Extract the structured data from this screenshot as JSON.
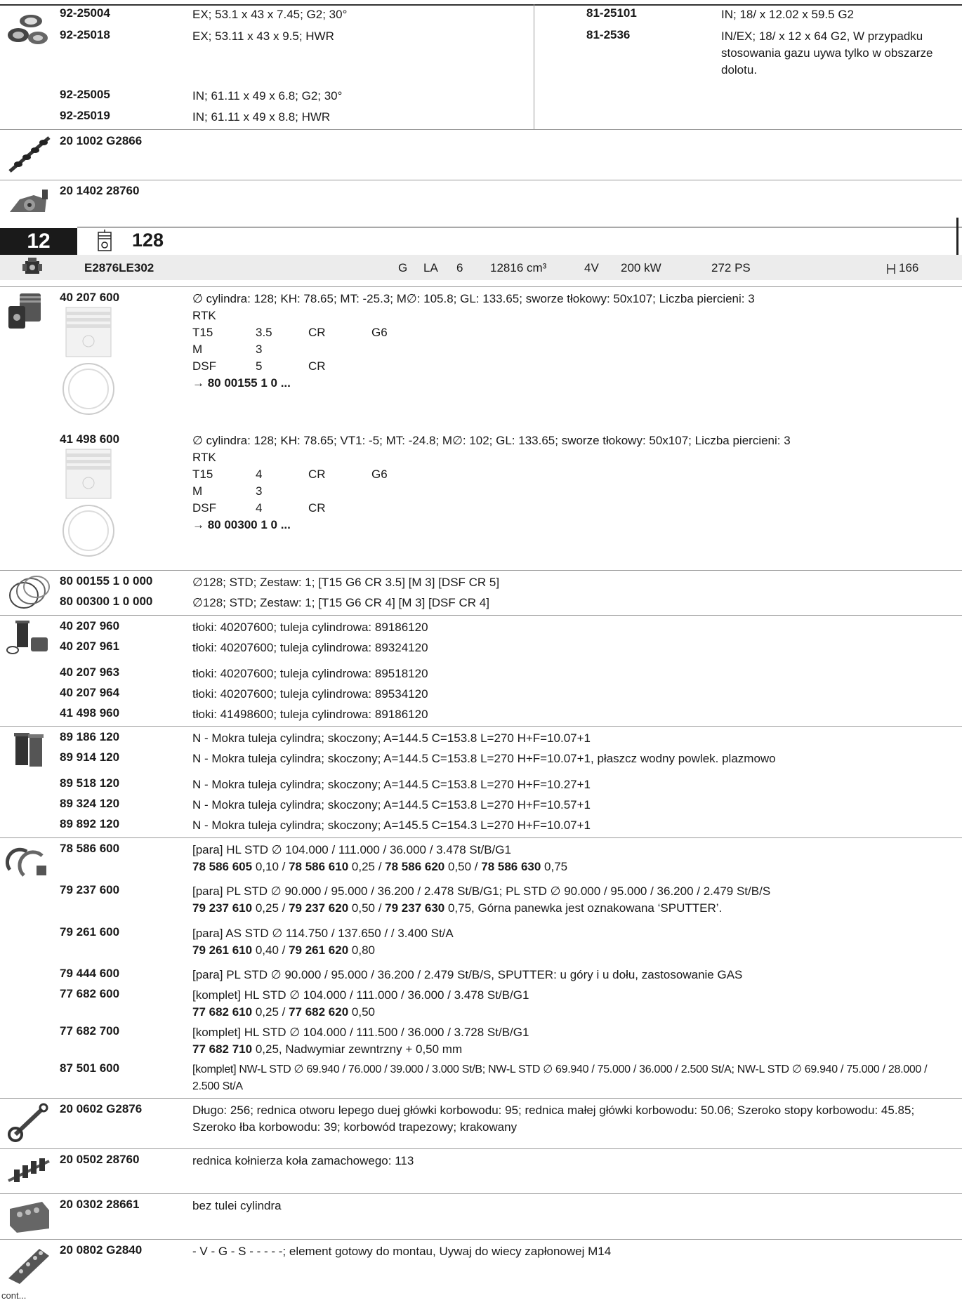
{
  "top_block": {
    "left": [
      {
        "pn": "92-25004",
        "desc": "EX; 53.1 x 43 x 7.45; G2; 30°"
      },
      {
        "pn": "92-25018",
        "desc": "EX; 53.11 x 43 x 9.5; HWR"
      },
      {
        "pn": "92-25005",
        "desc": "IN; 61.11 x 49 x 6.8; G2; 30°"
      },
      {
        "pn": "92-25019",
        "desc": "IN; 61.11 x 49 x 8.8; HWR"
      }
    ],
    "right": [
      {
        "pn": "81-25101",
        "desc": "IN; 18/ x 12.02 x 59.5 G2"
      },
      {
        "pn": "81-2536",
        "desc": "IN/EX; 18/ x 12 x 64 G2, W przypadku stosowania gazu uywa tylko w obszarze dolotu."
      }
    ]
  },
  "camshaft": {
    "pn": "20 1002 G2866"
  },
  "housing": {
    "pn": "20 1402 28760"
  },
  "engine_header": {
    "number": "12",
    "bore": "128",
    "code": "E2876LE302",
    "fuel": "G",
    "aspiration": "LA",
    "cylinders": "6",
    "displacement": "12816 cm³",
    "valves": "4V",
    "power_kw": "200 kW",
    "power_ps": "272 PS",
    "stroke": "166"
  },
  "pistons": [
    {
      "pn": "40 207 600",
      "desc": "∅ cylindra: 128; KH: 78.65; MT: -25.3; M∅: 105.8; GL: 133.65; sworze tłokowy: 50x107; Liczba piercieni: 3",
      "label": "RTK",
      "rings": [
        [
          "T15",
          "3.5",
          "CR",
          "G6"
        ],
        [
          "M",
          "3",
          "",
          ""
        ],
        [
          "DSF",
          "5",
          "CR",
          ""
        ]
      ],
      "ref": "→ 80 00155 1 0 ..."
    },
    {
      "pn": "41 498 600",
      "desc": "∅ cylindra: 128; KH: 78.65; VT1: -5; MT: -24.8; M∅: 102; GL: 133.65; sworze tłokowy: 50x107; Liczba piercieni: 3",
      "label": "RTK",
      "rings": [
        [
          "T15",
          "4",
          "CR",
          "G6"
        ],
        [
          "M",
          "3",
          "",
          ""
        ],
        [
          "DSF",
          "4",
          "CR",
          ""
        ]
      ],
      "ref": "→ 80 00300 1 0 ..."
    }
  ],
  "ring_sets": [
    {
      "pn": "80 00155 1 0 000",
      "desc": "∅128; STD; Zestaw: 1; [T15 G6 CR 3.5] [M 3] [DSF CR 5]"
    },
    {
      "pn": "80 00300 1 0 000",
      "desc": "∅128; STD; Zestaw: 1; [T15 G6 CR 4] [M 3] [DSF CR 4]"
    }
  ],
  "kits": [
    {
      "pn": "40 207 960",
      "desc": "tłoki: 40207600; tuleja cylindrowa: 89186120"
    },
    {
      "pn": "40 207 961",
      "desc": "tłoki: 40207600; tuleja cylindrowa: 89324120"
    },
    {
      "pn": "40 207 963",
      "desc": "tłoki: 40207600; tuleja cylindrowa: 89518120"
    },
    {
      "pn": "40 207 964",
      "desc": "tłoki: 40207600; tuleja cylindrowa: 89534120"
    },
    {
      "pn": "41 498 960",
      "desc": "tłoki: 41498600; tuleja cylindrowa: 89186120"
    }
  ],
  "liners": [
    {
      "pn": "89 186 120",
      "desc": "N - Mokra tuleja cylindra; skoczony; A=144.5 C=153.8 L=270 H+F=10.07+1"
    },
    {
      "pn": "89 914 120",
      "desc": "N - Mokra tuleja cylindra; skoczony; A=144.5 C=153.8 L=270 H+F=10.07+1, płaszcz wodny powlek. plazmowo"
    },
    {
      "pn": "89 518 120",
      "desc": "N - Mokra tuleja cylindra; skoczony; A=144.5 C=153.8 L=270 H+F=10.27+1"
    },
    {
      "pn": "89 324 120",
      "desc": "N - Mokra tuleja cylindra; skoczony; A=144.5 C=153.8 L=270 H+F=10.57+1"
    },
    {
      "pn": "89 892 120",
      "desc": "N - Mokra tuleja cylindra; skoczony; A=145.5 C=154.3 L=270 H+F=10.07+1"
    }
  ],
  "bearings": [
    {
      "pn": "78 586 600",
      "l1": "[para] HL STD ∅ 104.000 / 111.000 / 36.000 / 3.478 St/B/G1",
      "l2": [
        [
          "78 586 605",
          " 0,10 / "
        ],
        [
          "78 586 610",
          " 0,25 / "
        ],
        [
          "78 586 620",
          " 0,50 / "
        ],
        [
          "78 586 630",
          " 0,75"
        ]
      ]
    },
    {
      "pn": "79 237 600",
      "l1": "[para] PL STD ∅ 90.000 / 95.000 / 36.200 / 2.478 St/B/G1; PL STD ∅ 90.000 / 95.000 / 36.200 / 2.479 St/B/S",
      "l2": [
        [
          "79 237 610",
          " 0,25 / "
        ],
        [
          "79 237 620",
          " 0,50 / "
        ],
        [
          "79 237 630",
          " 0,75, Górna panewka jest oznakowana ‘SPUTTER’."
        ]
      ]
    },
    {
      "pn": "79 261 600",
      "l1": "[para] AS STD ∅ 114.750 / 137.650 / / 3.400 St/A",
      "l2": [
        [
          "79 261 610",
          " 0,40 / "
        ],
        [
          "79 261 620",
          " 0,80"
        ]
      ]
    },
    {
      "pn": "79 444 600",
      "l1": "[para] PL STD ∅ 90.000 / 95.000 / 36.200 / 2.479 St/B/S, SPUTTER: u góry i u dołu, zastosowanie GAS",
      "l2": []
    },
    {
      "pn": "77 682 600",
      "l1": "[komplet] HL STD ∅ 104.000 / 111.000 / 36.000 / 3.478 St/B/G1",
      "l2": [
        [
          "77 682 610",
          " 0,25 / "
        ],
        [
          "77 682 620",
          " 0,50"
        ]
      ]
    },
    {
      "pn": "77 682 700",
      "l1": "[komplet] HL STD ∅ 104.000 / 111.500 / 36.000 / 3.728 St/B/G1",
      "l2": [
        [
          "77 682 710",
          " 0,25, Nadwymiar zewntrzny + 0,50 mm"
        ]
      ]
    },
    {
      "pn": "87 501 600",
      "l1": "[komplet] NW-L STD ∅ 69.940 / 76.000 / 39.000 / 3.000 St/B; NW-L STD ∅ 69.940 / 75.000 / 36.000 / 2.500 St/A; NW-L STD ∅ 69.940 / 75.000 / 28.000 / 2.500 St/A",
      "l2": []
    }
  ],
  "conrod": {
    "pn": "20 0602 G2876",
    "desc": "Długo: 256; rednica otworu lepego duej główki korbowodu: 95; rednica małej główki korbowodu: 50.06; Szeroko stopy korbowodu: 45.85; Szeroko łba korbowodu: 39; korbowód trapezowy; krakowany"
  },
  "crankshaft": {
    "pn": "20 0502 28760",
    "desc": "rednica kołnierza koła zamachowego: 113"
  },
  "block": {
    "pn": "20 0302 28661",
    "desc": "bez tulei cylindra"
  },
  "head": {
    "pn": "20 0802 G2840",
    "desc": "- V - G - S - - - - -; element gotowy do montau, Uywaj do wiecy zapłonowej M14"
  },
  "footer": "cont..."
}
